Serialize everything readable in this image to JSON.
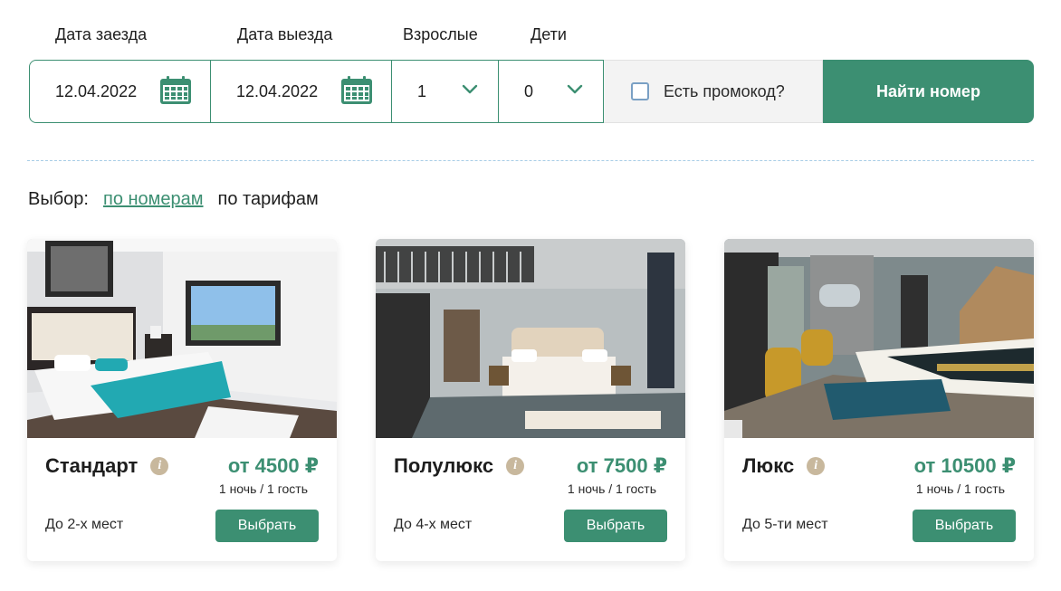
{
  "search": {
    "checkin_label": "Дата заезда",
    "checkout_label": "Дата выезда",
    "adults_label": "Взрослые",
    "kids_label": "Дети",
    "checkin_value": "12.04.2022",
    "checkout_value": "12.04.2022",
    "adults_value": "1",
    "kids_value": "0",
    "promo_label": "Есть промокод?",
    "find_button": "Найти номер"
  },
  "choice": {
    "label": "Выбор:",
    "by_rooms": "по номерам",
    "by_rates": "по тарифам"
  },
  "rooms": [
    {
      "name": "Стандарт",
      "price": "от 4500 ₽",
      "per": "1 ночь / 1 гость",
      "places": "До 2-х мест",
      "button": "Выбрать"
    },
    {
      "name": "Полулюкс",
      "price": "от 7500 ₽",
      "per": "1 ночь / 1 гость",
      "places": "До 4-х мест",
      "button": "Выбрать"
    },
    {
      "name": "Люкс",
      "price": "от 10500 ₽",
      "per": "1 ночь / 1 гость",
      "places": "До 5-ти мест",
      "button": "Выбрать"
    }
  ],
  "colors": {
    "accent": "#3c8f72",
    "info_badge": "#c8b89d",
    "divider": "#a8cde6"
  },
  "icons": [
    "calendar-icon",
    "chevron-down-icon",
    "info-icon"
  ]
}
